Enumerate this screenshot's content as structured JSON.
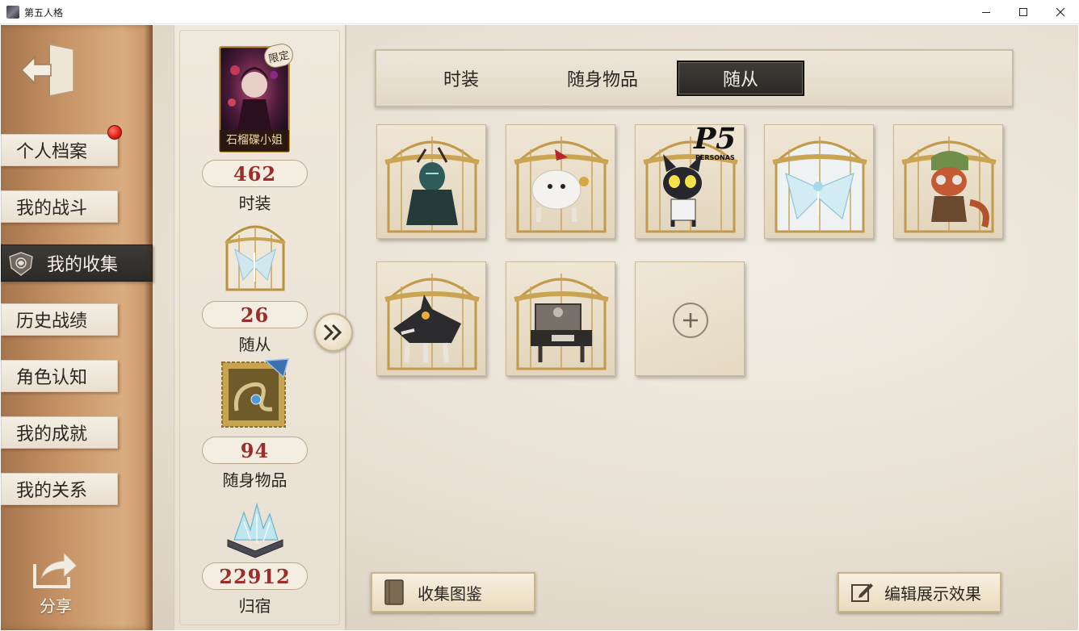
{
  "window": {
    "title": "第五人格",
    "controls": [
      "minimize",
      "maximize",
      "close"
    ]
  },
  "sidebar": {
    "items": [
      {
        "label": "个人档案",
        "badge": true
      },
      {
        "label": "我的战斗"
      },
      {
        "label": "我的收集",
        "active": true
      },
      {
        "label": "历史战绩"
      },
      {
        "label": "角色认知"
      },
      {
        "label": "我的成就"
      },
      {
        "label": "我的关系"
      }
    ],
    "share_label": "分享"
  },
  "summary": {
    "costume": {
      "tag": "限定",
      "name": "石榴碟小姐",
      "count": "462",
      "label": "时装"
    },
    "follower": {
      "count": "26",
      "label": "随从"
    },
    "accessory": {
      "count": "94",
      "label": "随身物品"
    },
    "dorm": {
      "count": "22912",
      "label": "归宿"
    }
  },
  "tabs": [
    {
      "label": "时装"
    },
    {
      "label": "随身物品"
    },
    {
      "label": "随从",
      "active": true
    }
  ],
  "grid": {
    "items": [
      {
        "icon": "tree-spirit-follower-icon"
      },
      {
        "icon": "white-dog-follower-icon"
      },
      {
        "icon": "morgana-cat-follower-icon",
        "logo_text": "P5",
        "logo_sub": "PERSONAS"
      },
      {
        "icon": "crystal-butterfly-follower-icon"
      },
      {
        "icon": "red-panda-follower-icon"
      },
      {
        "icon": "black-wolf-follower-icon"
      },
      {
        "icon": "mech-chair-follower-icon"
      }
    ],
    "empty_slot": "add-icon"
  },
  "buttons": {
    "collect": "收集图鉴",
    "edit": "编辑展示效果"
  },
  "colors": {
    "count_red": "#9b2d2a",
    "active_tab": "#2b2926",
    "badge_red": "#e1241b"
  }
}
